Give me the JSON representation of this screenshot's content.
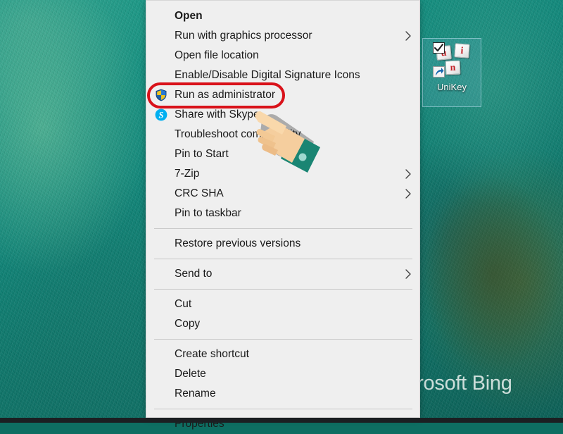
{
  "desktop": {
    "wallpaper_color": "#159182",
    "watermark": "Microsoft Bing",
    "icons": [
      {
        "label": "UniKey",
        "keys": [
          "u",
          "i",
          "n"
        ],
        "key_color": "#c22026",
        "has_checkbox": true,
        "has_shortcut_overlay": true,
        "selected": true
      }
    ]
  },
  "context_menu": {
    "accent_highlight_color": "#d9121a",
    "background_color": "#efefef",
    "items": [
      {
        "id": "open",
        "label": "Open",
        "bold": true,
        "icon": null,
        "submenu": false,
        "separator_after": false
      },
      {
        "id": "run-with-gpu",
        "label": "Run with graphics processor",
        "bold": false,
        "icon": null,
        "submenu": true,
        "separator_after": false
      },
      {
        "id": "open-file-loc",
        "label": "Open file location",
        "bold": false,
        "icon": null,
        "submenu": false,
        "separator_after": false
      },
      {
        "id": "digital-sig",
        "label": "Enable/Disable Digital Signature Icons",
        "bold": false,
        "icon": null,
        "submenu": false,
        "separator_after": false
      },
      {
        "id": "run-as-admin",
        "label": "Run as administrator",
        "bold": false,
        "icon": "shield-icon",
        "submenu": false,
        "separator_after": false,
        "highlighted": true
      },
      {
        "id": "share-skype",
        "label": "Share with Skype",
        "bold": false,
        "icon": "skype-icon",
        "submenu": false,
        "separator_after": false
      },
      {
        "id": "troubleshoot",
        "label": "Troubleshoot compatibility",
        "bold": false,
        "icon": null,
        "submenu": false,
        "separator_after": false
      },
      {
        "id": "pin-to-start",
        "label": "Pin to Start",
        "bold": false,
        "icon": null,
        "submenu": false,
        "separator_after": false
      },
      {
        "id": "7-zip",
        "label": "7-Zip",
        "bold": false,
        "icon": null,
        "submenu": true,
        "separator_after": false
      },
      {
        "id": "crc-sha",
        "label": "CRC SHA",
        "bold": false,
        "icon": null,
        "submenu": true,
        "separator_after": false
      },
      {
        "id": "pin-to-taskbar",
        "label": "Pin to taskbar",
        "bold": false,
        "icon": null,
        "submenu": false,
        "separator_after": true
      },
      {
        "id": "restore-prev",
        "label": "Restore previous versions",
        "bold": false,
        "icon": null,
        "submenu": false,
        "separator_after": true
      },
      {
        "id": "send-to",
        "label": "Send to",
        "bold": false,
        "icon": null,
        "submenu": true,
        "separator_after": true
      },
      {
        "id": "cut",
        "label": "Cut",
        "bold": false,
        "icon": null,
        "submenu": false,
        "separator_after": false
      },
      {
        "id": "copy",
        "label": "Copy",
        "bold": false,
        "icon": null,
        "submenu": false,
        "separator_after": true
      },
      {
        "id": "create-shortcut",
        "label": "Create shortcut",
        "bold": false,
        "icon": null,
        "submenu": false,
        "separator_after": false
      },
      {
        "id": "delete",
        "label": "Delete",
        "bold": false,
        "icon": null,
        "submenu": false,
        "separator_after": false
      },
      {
        "id": "rename",
        "label": "Rename",
        "bold": false,
        "icon": null,
        "submenu": false,
        "separator_after": true
      },
      {
        "id": "properties",
        "label": "Properties",
        "bold": false,
        "icon": null,
        "submenu": false,
        "separator_after": false
      }
    ]
  },
  "annotations": {
    "hand_cursor": {
      "skin_color": "#f5ce9e",
      "sleeve_color": "#1a8573"
    }
  }
}
